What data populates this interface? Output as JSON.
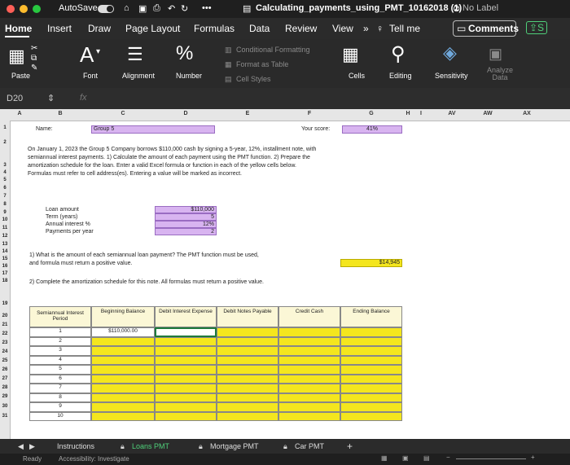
{
  "titlebar": {
    "autosave": "AutoSave",
    "doc_title": "Calculating_payments_using_PMT_10162018 (1)",
    "label": "No Label"
  },
  "tabs": [
    "Home",
    "Insert",
    "Draw",
    "Page Layout",
    "Formulas",
    "Data",
    "Review",
    "View"
  ],
  "tell_me": "Tell me",
  "comments": "Comments",
  "ribbon": {
    "paste": "Paste",
    "font": "Font",
    "alignment": "Alignment",
    "number": "Number",
    "conditional_formatting": "Conditional Formatting",
    "format_as_table": "Format as Table",
    "cell_styles": "Cell Styles",
    "cells": "Cells",
    "editing": "Editing",
    "sensitivity": "Sensitivity",
    "analyze_data": "Analyze Data"
  },
  "formula_bar": {
    "name_box": "D20",
    "fx": "fx"
  },
  "columns": [
    "A",
    "B",
    "C",
    "D",
    "E",
    "F",
    "G",
    "H",
    "I",
    "AV",
    "AW",
    "AX"
  ],
  "sheet": {
    "name_label": "Name:",
    "group_value": "Group 5",
    "score_label": "Your score:",
    "score_value": "41%",
    "problem_text": [
      "On January 1, 2023 the Group 5 Company borrows $110,000 cash by signing a 5-year, 12%, installment note, with",
      "semiannual interest payments.  1)  Calculate the amount of each payment using the PMT function.  2)  Prepare the",
      "amortization schedule for the loan.  Enter a valid Excel formula or function in each of the yellow cells below.",
      "Formulas must refer to cell address(es).  Entering a value will be marked as incorrect."
    ],
    "loan_labels": [
      "Loan amount",
      "Term (years)",
      "Annual interest %",
      "Payments per year"
    ],
    "loan_values": [
      "$110,000",
      "5",
      "12%",
      "2"
    ],
    "q1_text": [
      "1)  What is the amount of each semiannual loan payment?  The PMT function must be used,",
      "and formula must return a positive value."
    ],
    "q1_answer": "$14,945",
    "q2_text": "2)  Complete the amortization schedule for this note.  All formulas must return a positive value.",
    "table_headers": [
      "Semiannual Interest Period",
      "Beginning Balance",
      "Debit Interest Expense",
      "Debit Notes Payable",
      "Credit Cash",
      "Ending Balance"
    ],
    "periods": [
      "1",
      "2",
      "3",
      "4",
      "5",
      "6",
      "7",
      "8",
      "9",
      "10"
    ],
    "first_beginning_balance": "$110,000.00"
  },
  "sheet_tabs": [
    "Instructions",
    "Loans PMT",
    "Mortgage PMT",
    "Car PMT"
  ],
  "status": {
    "ready": "Ready",
    "accessibility": "Accessibility: Investigate"
  }
}
